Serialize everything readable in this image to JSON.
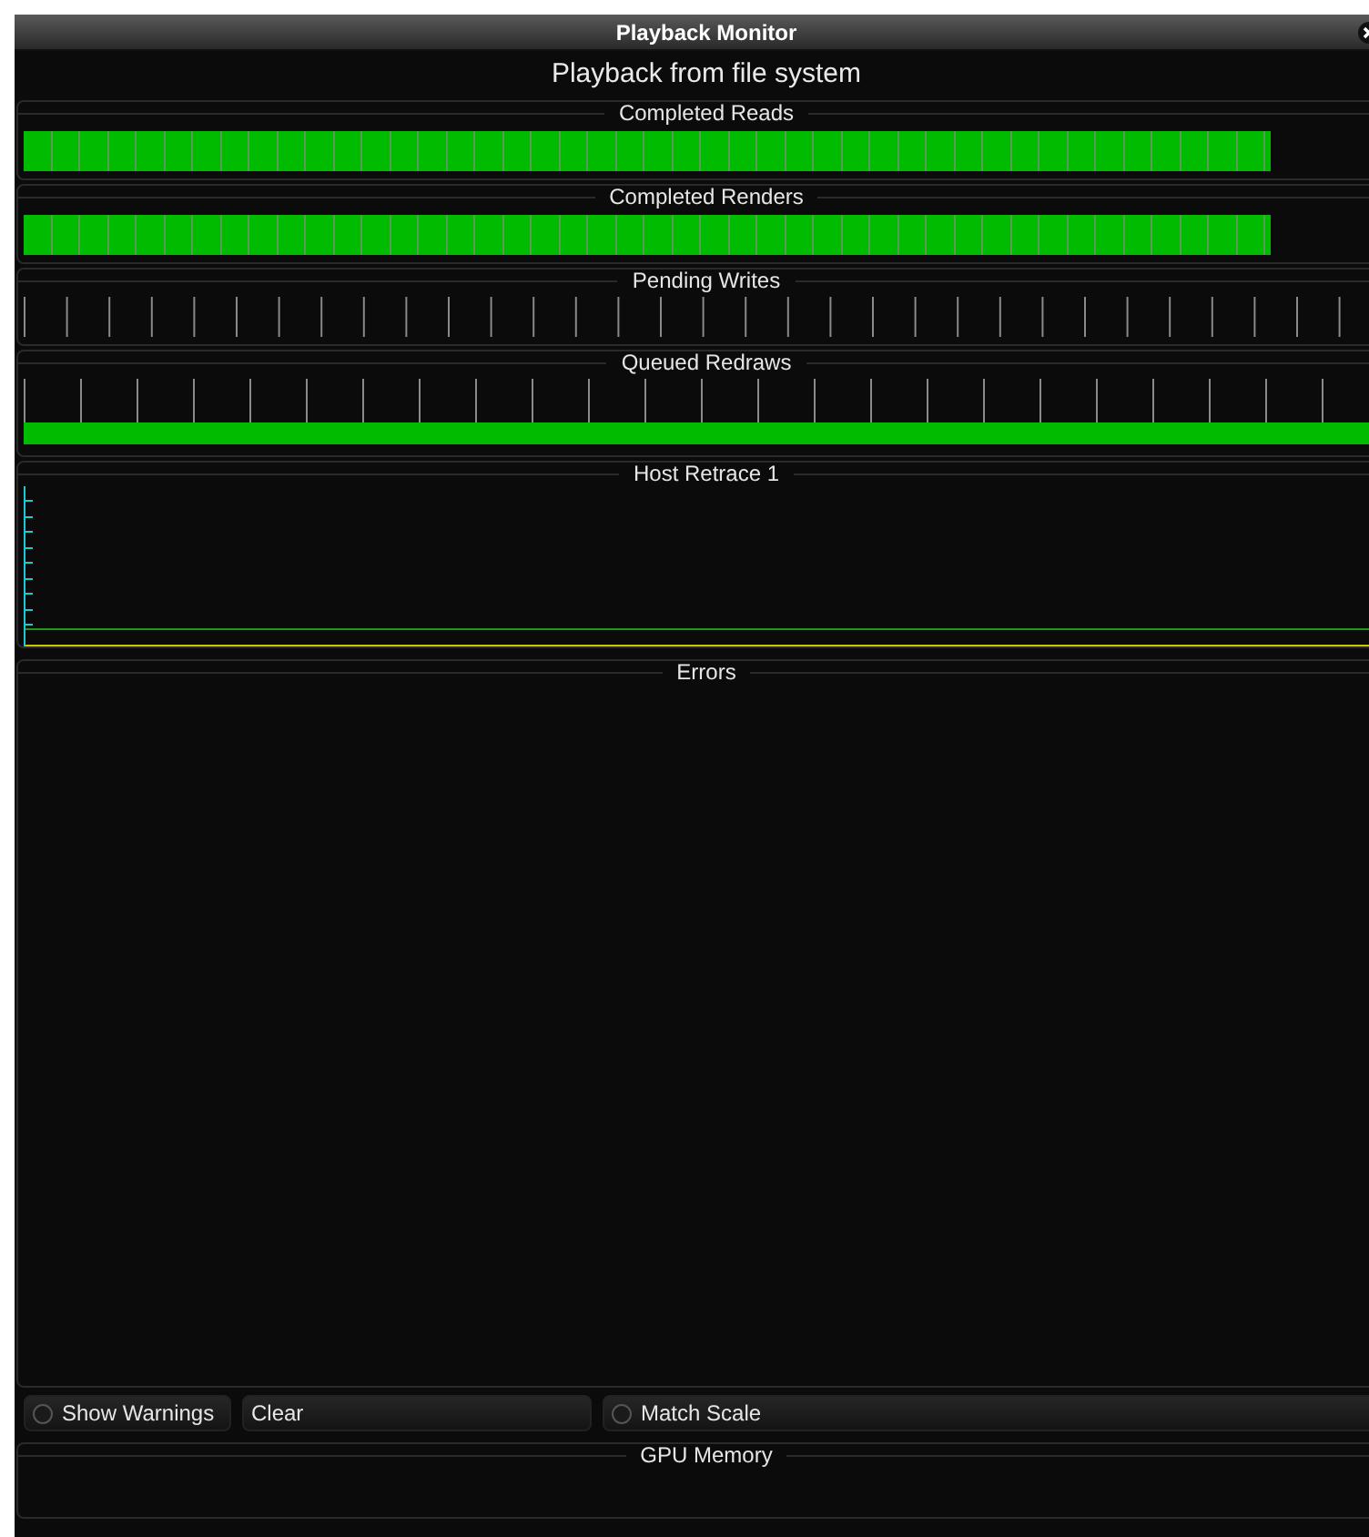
{
  "window": {
    "title": "Playback Monitor"
  },
  "heading": "Playback from file system",
  "meters": [
    {
      "title": "Completed Reads",
      "kind": "segmented",
      "level": 0.96
    },
    {
      "title": "Completed Renders",
      "kind": "segmented",
      "level": 0.96
    },
    {
      "title": "Pending Writes",
      "kind": "ticks"
    },
    {
      "title": "Queued Redraws",
      "kind": "ticks-bar",
      "level": 1
    }
  ],
  "graph": {
    "title": "Host Retrace 1"
  },
  "errors": {
    "title": "Errors"
  },
  "controls": [
    {
      "kind": "checkbox",
      "label": "Show Warnings",
      "checked": false
    },
    {
      "kind": "button",
      "label": "Clear"
    },
    {
      "kind": "checkbox",
      "label": "Match Scale",
      "checked": false
    }
  ],
  "gpu": {
    "title": "GPU Memory"
  }
}
